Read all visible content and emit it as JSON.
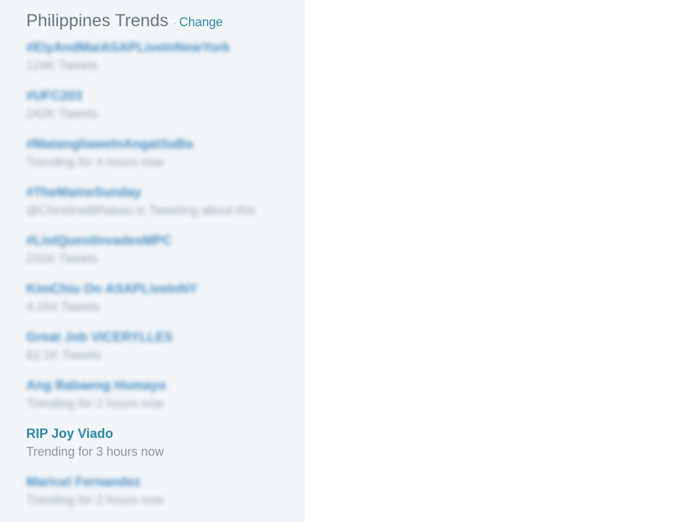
{
  "trends": {
    "title": "Philippines Trends",
    "separator": "·",
    "change_label": "Change",
    "items": [
      {
        "name": "#ElyAndMaiASAPLiveInNewYork",
        "meta": "124K Tweets",
        "blurred": true
      },
      {
        "name": "#UFC203",
        "meta": "242K Tweets",
        "blurred": true
      },
      {
        "name": "#MatangliaweInAngatSaBa",
        "meta": "Trending for 4 hours now",
        "blurred": true
      },
      {
        "name": "#TheMaineSunday",
        "meta": "@ChristineBRabao is Tweeting about this",
        "blurred": true
      },
      {
        "name": "#ListQuestInvadesMPC",
        "meta": "231K Tweets",
        "blurred": true
      },
      {
        "name": "KimChiu On ASAPLiveInNY",
        "meta": "4,164 Tweets",
        "blurred": true
      },
      {
        "name": "Great Job VICERYLLES",
        "meta": "62.1K Tweets",
        "blurred": true
      },
      {
        "name": "Ang Babaeng Humayo",
        "meta": "Trending for 2 hours now",
        "blurred": true
      },
      {
        "name": "RIP Joy Viado",
        "meta": "Trending for 3 hours now",
        "blurred": false
      },
      {
        "name": "Maricel Fernandez",
        "meta": "Trending for 2 hours now",
        "blurred": true
      }
    ]
  }
}
